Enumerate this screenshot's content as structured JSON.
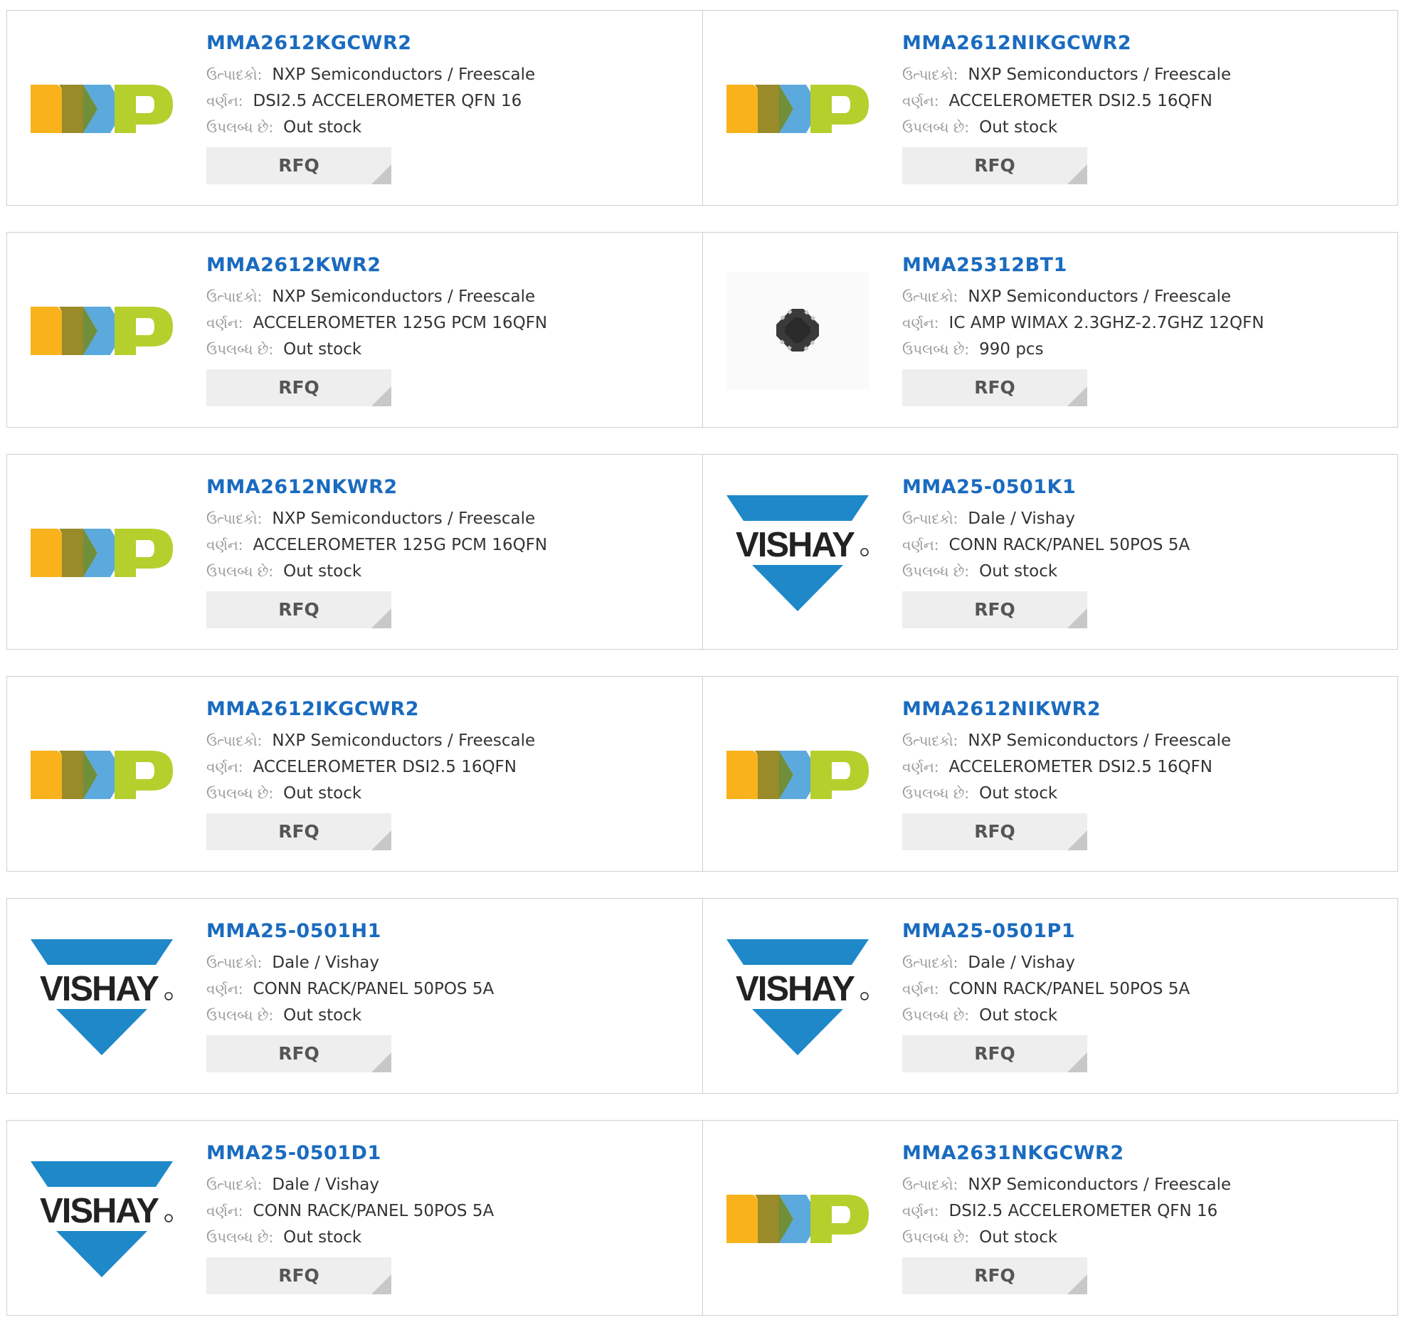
{
  "labels": {
    "manufacturer": "ઉત્પાદકો:",
    "description": "વર્ણન:",
    "availability": "ઉપલબ્ધ છે:",
    "rfq": "RFQ"
  },
  "brand_colors": {
    "link": "#1a6bbf",
    "nxp_orange": "#f9b21b",
    "nxp_blue": "#5ba9dd",
    "nxp_green": "#b5cf2d",
    "nxp_olive": "#998a2a",
    "vishay_blue": "#1e88c8"
  },
  "products": [
    {
      "part": "MMA2612KGCWR2",
      "logo": "nxp-logo",
      "manufacturer": "NXP Semiconductors / Freescale",
      "description": "DSI2.5 ACCELEROMETER QFN 16",
      "availability": "Out stock"
    },
    {
      "part": "MMA2612NIKGCWR2",
      "logo": "nxp-logo",
      "manufacturer": "NXP Semiconductors / Freescale",
      "description": "ACCELEROMETER DSI2.5 16QFN",
      "availability": "Out stock"
    },
    {
      "part": "MMA2612KWR2",
      "logo": "nxp-logo",
      "manufacturer": "NXP Semiconductors / Freescale",
      "description": "ACCELEROMETER 125G PCM 16QFN",
      "availability": "Out stock"
    },
    {
      "part": "MMA25312BT1",
      "logo": "qfn-chip-image",
      "manufacturer": "NXP Semiconductors / Freescale",
      "description": "IC AMP WIMAX 2.3GHZ-2.7GHZ 12QFN",
      "availability": "990 pcs"
    },
    {
      "part": "MMA2612NKWR2",
      "logo": "nxp-logo",
      "manufacturer": "NXP Semiconductors / Freescale",
      "description": "ACCELEROMETER 125G PCM 16QFN",
      "availability": "Out stock"
    },
    {
      "part": "MMA25-0501K1",
      "logo": "vishay-logo",
      "manufacturer": "Dale / Vishay",
      "description": "CONN RACK/PANEL 50POS 5A",
      "availability": "Out stock"
    },
    {
      "part": "MMA2612IKGCWR2",
      "logo": "nxp-logo",
      "manufacturer": "NXP Semiconductors / Freescale",
      "description": "ACCELEROMETER DSI2.5 16QFN",
      "availability": "Out stock"
    },
    {
      "part": "MMA2612NIKWR2",
      "logo": "nxp-logo",
      "manufacturer": "NXP Semiconductors / Freescale",
      "description": "ACCELEROMETER DSI2.5 16QFN",
      "availability": "Out stock"
    },
    {
      "part": "MMA25-0501H1",
      "logo": "vishay-logo",
      "manufacturer": "Dale / Vishay",
      "description": "CONN RACK/PANEL 50POS 5A",
      "availability": "Out stock"
    },
    {
      "part": "MMA25-0501P1",
      "logo": "vishay-logo",
      "manufacturer": "Dale / Vishay",
      "description": "CONN RACK/PANEL 50POS 5A",
      "availability": "Out stock"
    },
    {
      "part": "MMA25-0501D1",
      "logo": "vishay-logo",
      "manufacturer": "Dale / Vishay",
      "description": "CONN RACK/PANEL 50POS 5A",
      "availability": "Out stock"
    },
    {
      "part": "MMA2631NKGCWR2",
      "logo": "nxp-logo",
      "manufacturer": "NXP Semiconductors / Freescale",
      "description": "DSI2.5 ACCELEROMETER QFN 16",
      "availability": "Out stock"
    }
  ]
}
